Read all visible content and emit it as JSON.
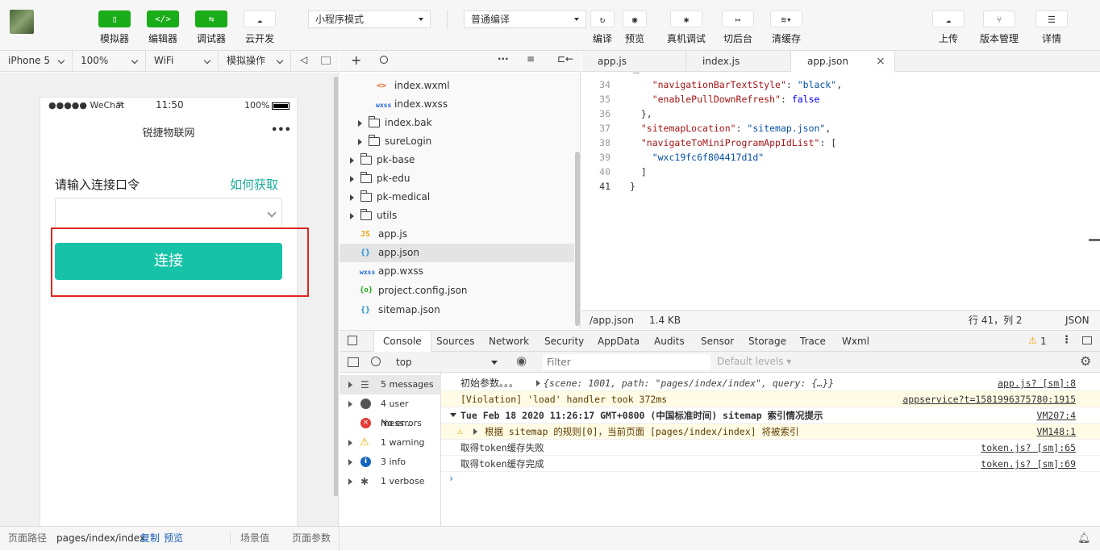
{
  "toolbar": {
    "buttons": [
      {
        "label": "模拟器",
        "icon": "phone-icon"
      },
      {
        "label": "编辑器",
        "icon": "code-icon"
      },
      {
        "label": "调试器",
        "icon": "debug-icon"
      },
      {
        "label": "云开发",
        "icon": "cloud-icon"
      }
    ],
    "mode_select": "小程序模式",
    "compile_select": "普通编译",
    "actions": [
      {
        "label": "编译"
      },
      {
        "label": "预览"
      },
      {
        "label": "真机调试"
      },
      {
        "label": "切后台"
      },
      {
        "label": "清缓存"
      }
    ],
    "right_actions": [
      {
        "label": "上传"
      },
      {
        "label": "版本管理"
      },
      {
        "label": "详情"
      }
    ]
  },
  "device_bar": {
    "device": "iPhone 5",
    "zoom": "100%",
    "network": "WiFi",
    "operation": "模拟操作"
  },
  "phone": {
    "status": {
      "carrier": "●●●●● WeChat",
      "time": "11:50",
      "battery": "100%"
    },
    "nav_title": "锐捷物联网",
    "menu_dots": "•••",
    "label": "请输入连接口令",
    "help_link": "如何获取",
    "connect_button": "连接"
  },
  "file_tree": {
    "items": [
      {
        "name": "index.wxml",
        "type": "wxml",
        "badge": "<>"
      },
      {
        "name": "index.wxss",
        "type": "wxss",
        "badge": "wxss"
      },
      {
        "name": "index.bak",
        "type": "folder"
      },
      {
        "name": "sureLogin",
        "type": "folder"
      },
      {
        "name": "pk-base",
        "type": "folder"
      },
      {
        "name": "pk-edu",
        "type": "folder"
      },
      {
        "name": "pk-medical",
        "type": "folder"
      },
      {
        "name": "utils",
        "type": "folder"
      },
      {
        "name": "app.js",
        "type": "js",
        "badge": "JS"
      },
      {
        "name": "app.json",
        "type": "json",
        "badge": "{}"
      },
      {
        "name": "app.wxss",
        "type": "wxss",
        "badge": "wxss"
      },
      {
        "name": "project.config.json",
        "type": "json",
        "badge": "{o}"
      },
      {
        "name": "sitemap.json",
        "type": "json",
        "badge": "{}"
      }
    ]
  },
  "editor": {
    "tabs": [
      {
        "label": "app.js"
      },
      {
        "label": "index.js"
      },
      {
        "label": "app.json",
        "active": true
      }
    ],
    "lines": [
      {
        "n": "34",
        "text": "    \"navigationBarTextStyle\": \"black\","
      },
      {
        "n": "35",
        "text": "    \"enablePullDownRefresh\": false"
      },
      {
        "n": "36",
        "text": "  },"
      },
      {
        "n": "37",
        "text": "  \"sitemapLocation\": \"sitemap.json\","
      },
      {
        "n": "38",
        "text": "  \"navigateToMiniProgramAppIdList\": ["
      },
      {
        "n": "39",
        "text": "    \"wxc19fc6f804417d1d\""
      },
      {
        "n": "40",
        "text": "  ]"
      },
      {
        "n": "41",
        "text": "}"
      }
    ],
    "status": {
      "path": "/app.json",
      "size": "1.4 KB",
      "position": "行 41，列 2",
      "lang": "JSON"
    }
  },
  "devtools": {
    "tabs": [
      "Console",
      "Sources",
      "Network",
      "Security",
      "AppData",
      "Audits",
      "Sensor",
      "Storage",
      "Trace",
      "Wxml"
    ],
    "warning_count": "1",
    "context": "top",
    "filter_placeholder": "Filter",
    "levels": "Default levels",
    "sidebar": [
      {
        "label": "5 messages",
        "icon": "list-icon"
      },
      {
        "label": "4 user mess...",
        "icon": "user-icon"
      },
      {
        "label": "No errors",
        "icon": "error-icon"
      },
      {
        "label": "1 warning",
        "icon": "warning-icon"
      },
      {
        "label": "3 info",
        "icon": "info-icon"
      },
      {
        "label": "1 verbose",
        "icon": "verbose-icon"
      }
    ],
    "messages": [
      {
        "text": "初始参数。。。",
        "extra": "{scene: 1001, path: \"pages/index/index\", query: {…}}",
        "src": "app.js? [sm]:8",
        "type": "log"
      },
      {
        "text": "[Violation] 'load' handler took 372ms",
        "src": "appservice?t=1581996375780:1915",
        "type": "violation"
      },
      {
        "text": "Tue Feb 18 2020 11:26:17 GMT+0800 (中国标准时间) sitemap 索引情况提示",
        "src": "VM207:4",
        "type": "group"
      },
      {
        "text": "根据 sitemap 的规则[0]，当前页面 [pages/index/index] 将被索引",
        "src": "VM148:1",
        "type": "warning"
      },
      {
        "text": "取得token缓存失败",
        "src": "token.js? [sm]:65",
        "type": "log"
      },
      {
        "text": "取得token缓存完成",
        "src": "token.js? [sm]:69",
        "type": "log"
      }
    ]
  },
  "bottom": {
    "path_label": "页面路径",
    "path": "pages/index/index",
    "copy": "复制",
    "preview": "预览",
    "scene": "场景值",
    "params": "页面参数"
  }
}
